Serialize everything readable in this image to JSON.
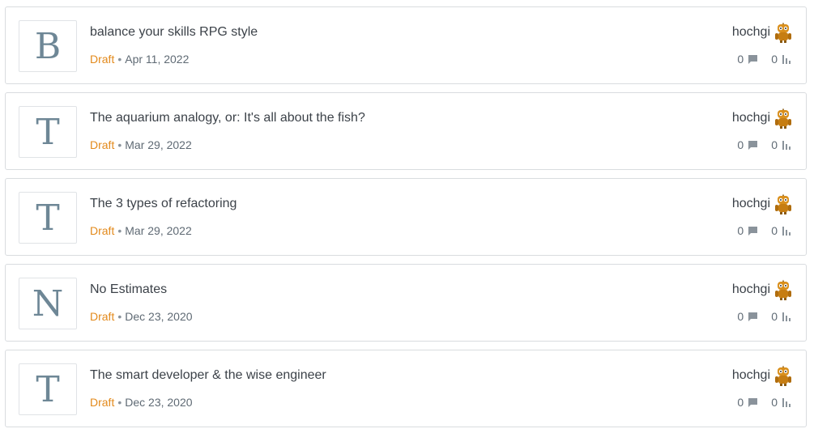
{
  "posts": [
    {
      "thumb_letter": "B",
      "title": "balance your skills RPG style",
      "status": "Draft",
      "separator": "•",
      "date": "Apr 11, 2022",
      "author": "hochgi",
      "comments": "0",
      "views": "0"
    },
    {
      "thumb_letter": "T",
      "title": "The aquarium analogy, or: It's all about the fish?",
      "status": "Draft",
      "separator": "•",
      "date": "Mar 29, 2022",
      "author": "hochgi",
      "comments": "0",
      "views": "0"
    },
    {
      "thumb_letter": "T",
      "title": "The 3 types of refactoring",
      "status": "Draft",
      "separator": "•",
      "date": "Mar 29, 2022",
      "author": "hochgi",
      "comments": "0",
      "views": "0"
    },
    {
      "thumb_letter": "N",
      "title": "No Estimates",
      "status": "Draft",
      "separator": "•",
      "date": "Dec 23, 2020",
      "author": "hochgi",
      "comments": "0",
      "views": "0"
    },
    {
      "thumb_letter": "T",
      "title": "The smart developer & the wise engineer",
      "status": "Draft",
      "separator": "•",
      "date": "Dec 23, 2020",
      "author": "hochgi",
      "comments": "0",
      "views": "0"
    }
  ],
  "colors": {
    "status_draft": "#e38a1c",
    "thumb_letter": "#6e8796",
    "border": "#d9dcdf"
  },
  "icons": {
    "comment": "comment-bubble-icon",
    "views": "bar-chart-icon",
    "avatar": "robot-avatar-icon"
  }
}
